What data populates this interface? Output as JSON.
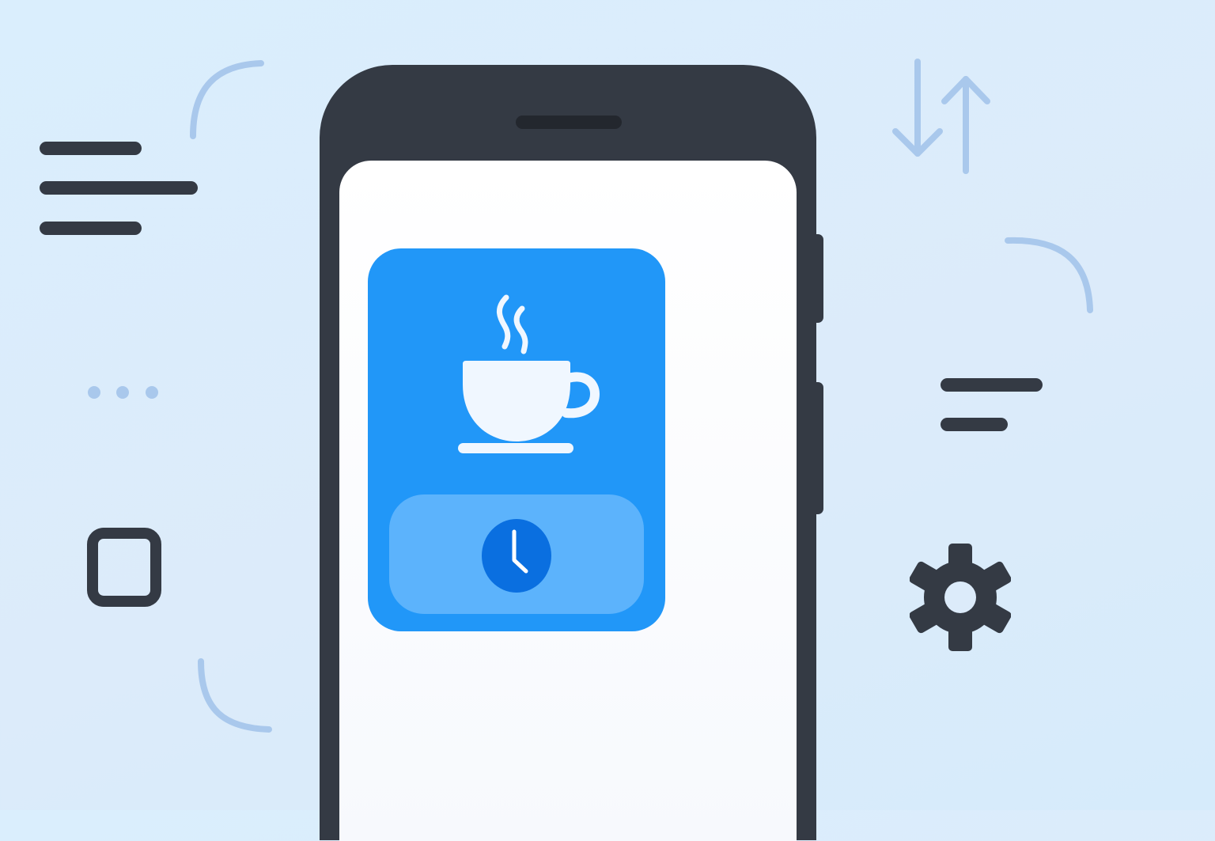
{
  "colors": {
    "background": "#dcedfb",
    "phone_frame": "#343a44",
    "screen": "#ffffff",
    "widget": "#2197f8",
    "timer_button": "#5cb3fc",
    "clock_face": "#0a6fe0",
    "decor_light": "#a9c8ec",
    "icon_dark": "#343a44"
  },
  "icons": {
    "widget_icon": "coffee-cup-icon",
    "button_icon": "clock-icon",
    "left_top": "menu-lines-icon",
    "left_middle": "more-dots-icon",
    "left_bottom": "square-icon",
    "right_top": "sort-arrows-icon",
    "right_middle": "filter-lines-icon",
    "right_bottom": "gear-icon"
  }
}
